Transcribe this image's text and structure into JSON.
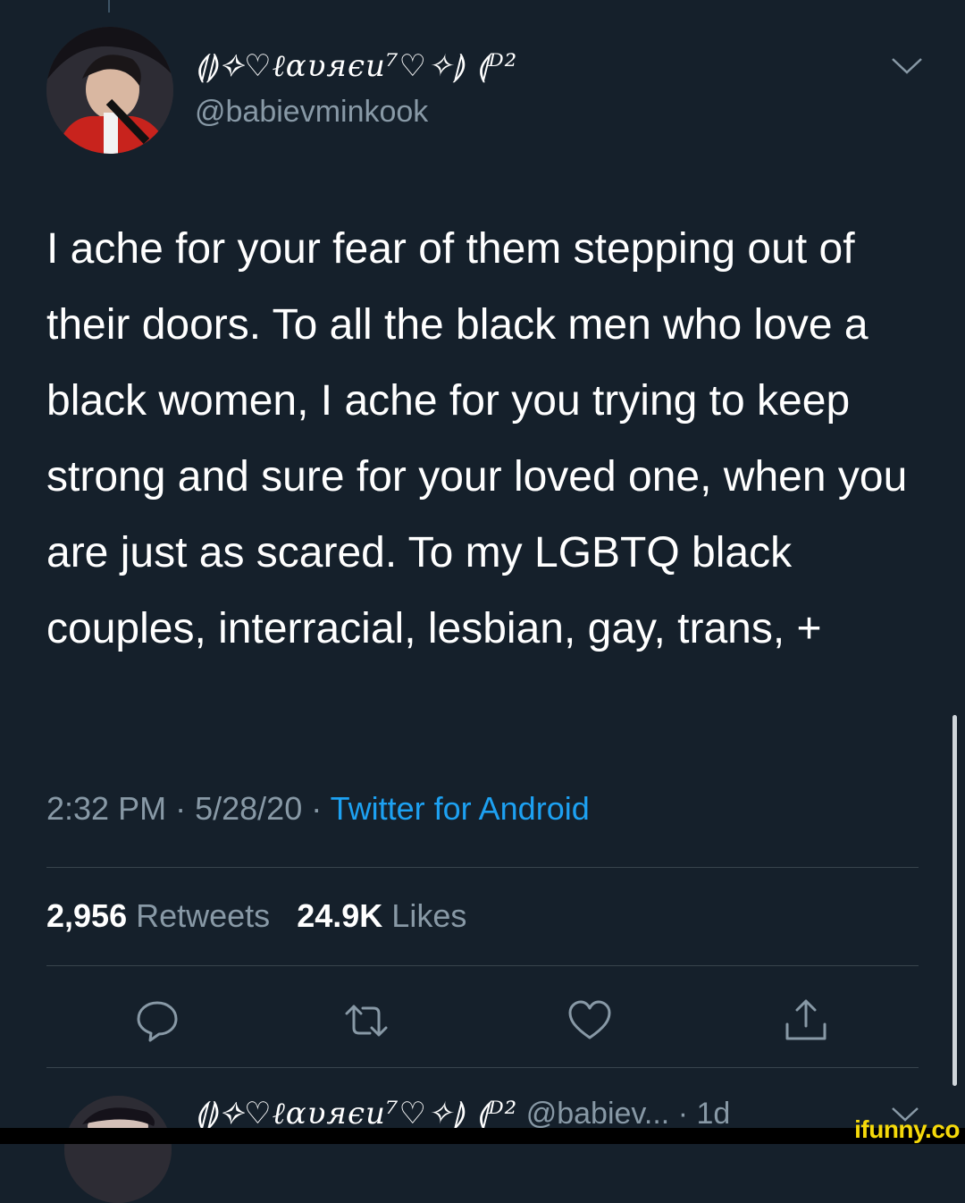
{
  "tweet": {
    "display_name": "⟬⟭✧♡ℓαυяєи⁷♡✧⟭ ⟬ᴰ²",
    "handle": "@babievminkook",
    "text": "I ache for your fear of them stepping out of their doors. To all the black men who love a black women, I ache for you trying to keep strong and sure for your loved one, when you are just as scared. To my LGBTQ black couples, interracial, lesbian, gay, trans, +",
    "time": "2:32 PM",
    "sep1": "·",
    "date": "5/28/20",
    "sep2": "·",
    "source": "Twitter for Android",
    "retweets_count": "2,956",
    "retweets_label": "Retweets",
    "likes_count": "24.9K",
    "likes_label": "Likes"
  },
  "icons": {
    "menu": "chevron-down-icon",
    "reply": "reply-icon",
    "retweet": "retweet-icon",
    "like": "heart-icon",
    "share": "share-icon"
  },
  "reply_preview": {
    "display_name": "⟬⟭✧♡ℓαυяєи⁷♡✧⟭ ⟬ᴰ²",
    "handle": "@babiev...",
    "sep": "·",
    "age": "1d"
  },
  "watermark": "ifunny.co",
  "colors": {
    "background": "#15202b",
    "text": "#ffffff",
    "muted": "#8899a6",
    "accent": "#1da1f2",
    "divider": "#38444d"
  }
}
